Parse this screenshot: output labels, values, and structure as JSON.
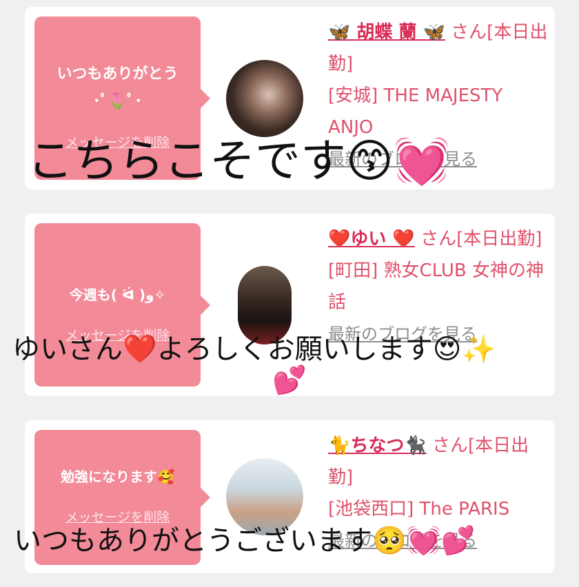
{
  "cards": [
    {
      "message": "いつもありがとう",
      "message_deco": "･ﾟ🌷ﾟ･",
      "delete_label": "メッセージを削除",
      "name": "🦋 胡蝶 蘭 🦋",
      "honorific": " さん",
      "status": "[本日出勤]",
      "shop": "[安城] THE MAJESTY ANJO",
      "blog_label": "最新のブログを見る"
    },
    {
      "message": "今週も( ᐛ )و✧",
      "delete_label": "メッセージを削除",
      "name": "❤️ゆい ❤️",
      "honorific": " さん",
      "status": "[本日出勤]",
      "shop": "[町田] 熟女CLUB 女神の神話",
      "blog_label": "最新のブログを見る"
    },
    {
      "message": "勉強になります🥰",
      "delete_label": "メッセージを削除",
      "name": "🐈ちなつ🐈‍⬛",
      "honorific": " さん",
      "status": "[本日出勤]",
      "shop": "[池袋西口] The PARIS",
      "blog_label": "最新のブログを見る"
    }
  ],
  "overlays": {
    "caption1": "こちらこそです😙💓",
    "caption2": "ゆいさん❤️よろしくお願いします😍✨",
    "caption2_extra": "💕",
    "caption3": "いつもありがとうございます🥺💓💕"
  },
  "colors": {
    "bubble": "#f28a98",
    "accent": "#e0506b",
    "background": "#f0f0f2"
  }
}
